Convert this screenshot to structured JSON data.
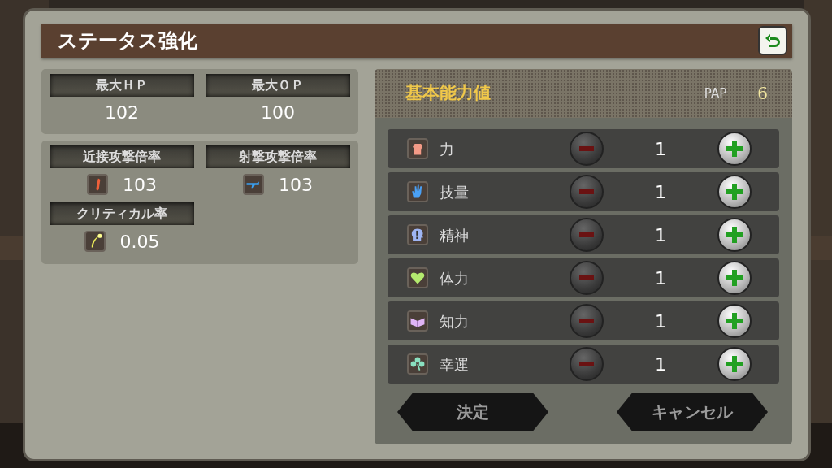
{
  "window": {
    "title": "ステータス強化"
  },
  "summary": [
    {
      "label": "最大ＨＰ",
      "value": "102"
    },
    {
      "label": "最大ＯＰ",
      "value": "100"
    }
  ],
  "rates": [
    {
      "label": "近接攻撃倍率",
      "value": "103"
    },
    {
      "label": "射撃攻撃倍率",
      "value": "103"
    },
    {
      "label": "クリティカル率",
      "value": "0.05"
    }
  ],
  "abilities": {
    "title": "基本能力値",
    "points_label": "PAP",
    "points": "6",
    "stats": [
      {
        "name": "力",
        "value": "1",
        "minus_enabled": false,
        "plus_enabled": true
      },
      {
        "name": "技量",
        "value": "1",
        "minus_enabled": false,
        "plus_enabled": true
      },
      {
        "name": "精神",
        "value": "1",
        "minus_enabled": false,
        "plus_enabled": true
      },
      {
        "name": "体力",
        "value": "1",
        "minus_enabled": false,
        "plus_enabled": true
      },
      {
        "name": "知力",
        "value": "1",
        "minus_enabled": false,
        "plus_enabled": true
      },
      {
        "name": "幸運",
        "value": "1",
        "minus_enabled": false,
        "plus_enabled": true
      }
    ]
  },
  "buttons": [
    "決定",
    "キャンセル"
  ]
}
